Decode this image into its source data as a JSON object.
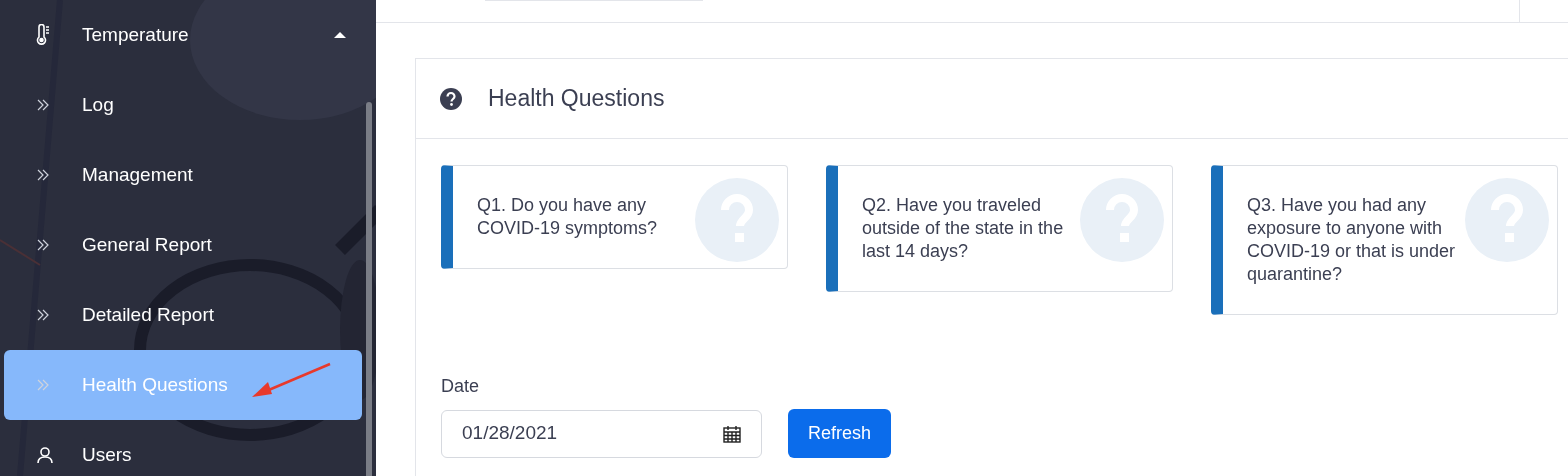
{
  "sidebar": {
    "items": [
      {
        "kind": "group",
        "label": "Temperature",
        "expanded": true,
        "selected": false
      },
      {
        "kind": "sub",
        "label": "Log",
        "selected": false
      },
      {
        "kind": "sub",
        "label": "Management",
        "selected": false
      },
      {
        "kind": "sub",
        "label": "General Report",
        "selected": false
      },
      {
        "kind": "sub",
        "label": "Detailed Report",
        "selected": false
      },
      {
        "kind": "sub",
        "label": "Health Questions",
        "selected": true
      },
      {
        "kind": "users",
        "label": "Users",
        "selected": false
      }
    ]
  },
  "panel": {
    "title": "Health Questions",
    "questions": [
      {
        "text": "Q1. Do you have any COVID-19 symptoms?"
      },
      {
        "text": "Q2. Have you traveled outside of the state in the last 14 days?"
      },
      {
        "text": "Q3. Have you had any exposure to anyone with COVID-19 or that is under quarantine?"
      }
    ],
    "date": {
      "label": "Date",
      "value": "01/28/2021"
    },
    "button": "Refresh"
  }
}
